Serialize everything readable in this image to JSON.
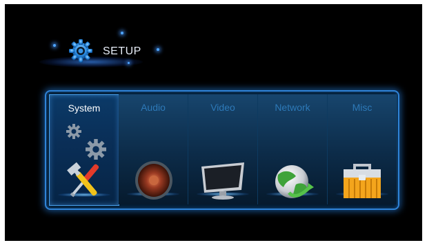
{
  "header": {
    "title": "SETUP",
    "icon": "gear-icon"
  },
  "menu": {
    "selected": "System",
    "tabs": [
      {
        "label": "System",
        "icon": "tools-icon"
      },
      {
        "label": "Audio",
        "icon": "speaker-icon"
      },
      {
        "label": "Video",
        "icon": "monitor-icon"
      },
      {
        "label": "Network",
        "icon": "globe-icon"
      },
      {
        "label": "Misc",
        "icon": "toolbox-icon"
      }
    ]
  },
  "colors": {
    "accent": "#2f84d8",
    "inactive_label": "#2d79b8",
    "active_label": "#ffffff"
  }
}
